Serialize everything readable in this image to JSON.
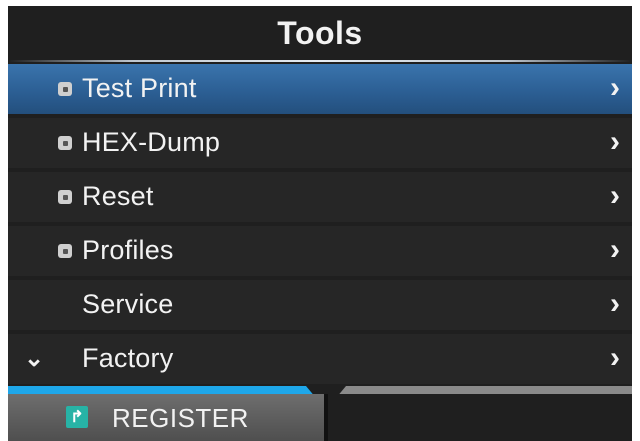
{
  "header": {
    "title": "Tools"
  },
  "menu": {
    "items": [
      {
        "label": "Test Print",
        "locked": true,
        "selected": true
      },
      {
        "label": "HEX-Dump",
        "locked": true,
        "selected": false
      },
      {
        "label": "Reset",
        "locked": true,
        "selected": false
      },
      {
        "label": "Profiles",
        "locked": true,
        "selected": false
      },
      {
        "label": "Service",
        "locked": false,
        "selected": false
      },
      {
        "label": "Factory",
        "locked": false,
        "selected": false
      }
    ],
    "arrow_glyph": "›",
    "scroll_more_glyph": "⌄"
  },
  "scroll_progress": 0.5,
  "softkeys": {
    "left_label": "REGISTER",
    "left_icon_glyph": "↱",
    "right_label": ""
  },
  "colors": {
    "selected_row": "#2c5f94",
    "progress_fill": "#1ea7ea",
    "register_icon": "#27b3a6"
  }
}
